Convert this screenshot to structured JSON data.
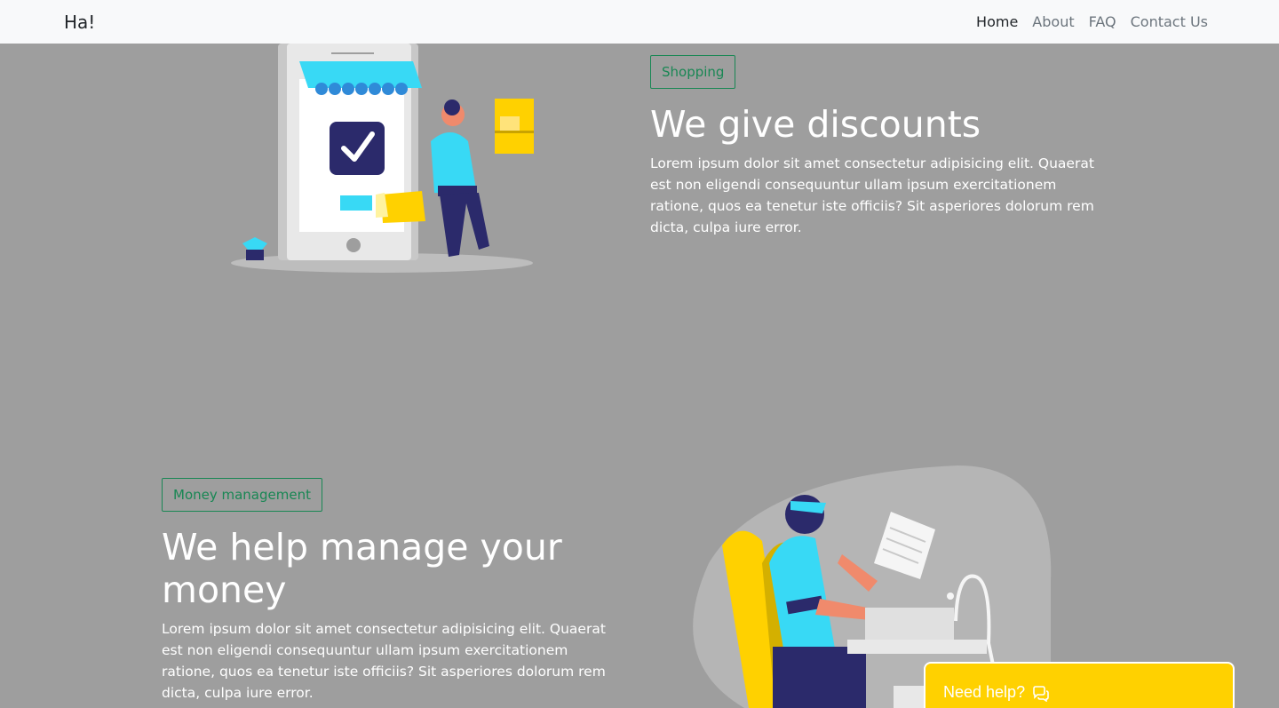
{
  "navbar": {
    "brand": "Ha!",
    "items": [
      {
        "label": "Home",
        "active": true
      },
      {
        "label": "About",
        "active": false
      },
      {
        "label": "FAQ",
        "active": false
      },
      {
        "label": "Contact Us",
        "active": false
      }
    ]
  },
  "sections": [
    {
      "badge": "Shopping",
      "title": "We give discounts",
      "body": "Lorem ipsum dolor sit amet consectetur adipisicing elit. Quaerat est non eligendi consequuntur ullam ipsum exercitationem ratione, quos ea tenetur iste officiis? Sit asperiores dolorum rem dicta, culpa iure error."
    },
    {
      "badge": "Money management",
      "title": "We help manage your money",
      "body": "Lorem ipsum dolor sit amet consectetur adipisicing elit. Quaerat est non eligendi consequuntur ullam ipsum exercitationem ratione, quos ea tenetur iste officiis? Sit asperiores dolorum rem dicta, culpa iure error."
    }
  ],
  "help_button": {
    "label": "Need help?",
    "icon": "chat-icon"
  },
  "colors": {
    "overlay_gray": "#9e9e9e",
    "navbar_bg": "#f8f9fa",
    "badge_green": "#198754",
    "help_yellow": "#ffd100",
    "accent_cyan": "#38d9f5",
    "navy": "#2b2a6b"
  }
}
